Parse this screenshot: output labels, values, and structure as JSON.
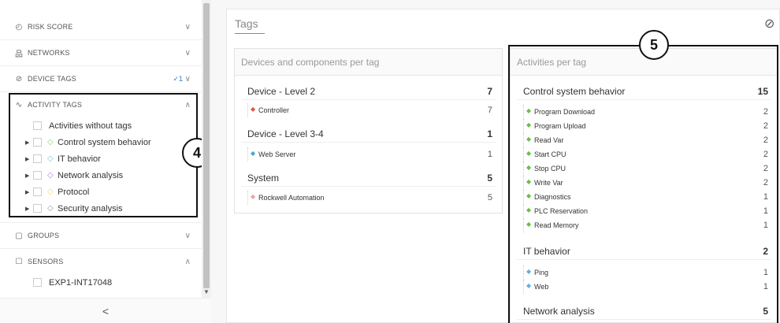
{
  "sidebar": {
    "sections": [
      {
        "label": "RISK SCORE",
        "icon": "clock-icon",
        "chevron": "∨"
      },
      {
        "label": "NETWORKS",
        "icon": "network-icon",
        "chevron": "∨"
      },
      {
        "label": "DEVICE TAGS",
        "icon": "tag-icon",
        "badge": "✓1",
        "chevron": "∨"
      },
      {
        "label": "ACTIVITY TAGS",
        "icon": "activity-icon",
        "chevron": "∧"
      },
      {
        "label": "GROUPS",
        "icon": "groups-icon",
        "chevron": "∨"
      },
      {
        "label": "SENSORS",
        "icon": "sensor-icon",
        "chevron": "∧"
      }
    ],
    "activity_items": [
      {
        "label": "Activities without tags",
        "color": ""
      },
      {
        "label": "Control system behavior",
        "color": "#8fd16b"
      },
      {
        "label": "IT behavior",
        "color": "#6ac8e8"
      },
      {
        "label": "Network analysis",
        "color": "#9a8ad8"
      },
      {
        "label": "Protocol",
        "color": "#f2d45c"
      },
      {
        "label": "Security analysis",
        "color": "#999999"
      }
    ],
    "sensor_items": [
      {
        "label": "EXP1-INT17048"
      }
    ],
    "collapse_label": "<"
  },
  "annotations": {
    "box4": "4",
    "box5": "5"
  },
  "main": {
    "title": "Tags",
    "devices_panel": {
      "title": "Devices and components per tag",
      "groups": [
        {
          "label": "Device - Level 2",
          "count": "7",
          "items": [
            {
              "label": "Controller",
              "count": "7",
              "color": "#e05a3a"
            }
          ]
        },
        {
          "label": "Device - Level 3-4",
          "count": "1",
          "items": [
            {
              "label": "Web Server",
              "count": "1",
              "color": "#3aa9d9"
            }
          ]
        },
        {
          "label": "System",
          "count": "5",
          "items": [
            {
              "label": "Rockwell Automation",
              "count": "5",
              "color": "#f0a0a0"
            }
          ]
        }
      ]
    },
    "activities_panel": {
      "title": "Activities per tag",
      "groups": [
        {
          "label": "Control system behavior",
          "count": "15",
          "items": [
            {
              "label": "Program Download",
              "count": "2",
              "color": "#6bbf4a"
            },
            {
              "label": "Program Upload",
              "count": "2",
              "color": "#6bbf4a"
            },
            {
              "label": "Read Var",
              "count": "2",
              "color": "#6bbf4a"
            },
            {
              "label": "Start CPU",
              "count": "2",
              "color": "#6bbf4a"
            },
            {
              "label": "Stop CPU",
              "count": "2",
              "color": "#6bbf4a"
            },
            {
              "label": "Write Var",
              "count": "2",
              "color": "#6bbf4a"
            },
            {
              "label": "Diagnostics",
              "count": "1",
              "color": "#6bbf4a"
            },
            {
              "label": "PLC Reservation",
              "count": "1",
              "color": "#6bbf4a"
            },
            {
              "label": "Read Memory",
              "count": "1",
              "color": "#6bbf4a"
            }
          ]
        },
        {
          "label": "IT behavior",
          "count": "2",
          "items": [
            {
              "label": "Ping",
              "count": "1",
              "color": "#5fb5e0"
            },
            {
              "label": "Web",
              "count": "1",
              "color": "#5fb5e0"
            }
          ]
        },
        {
          "label": "Network analysis",
          "count": "5",
          "items": []
        }
      ]
    }
  }
}
